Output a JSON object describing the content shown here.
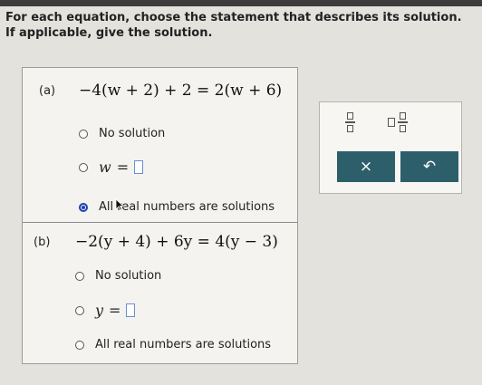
{
  "instructions": {
    "line1": "For each equation, choose the statement that describes its solution.",
    "line2": "If applicable, give the solution."
  },
  "parts": [
    {
      "label": "(a)",
      "equation": "−4(w + 2) + 2 = 2(w + 6)",
      "variable": "w",
      "options": {
        "no_solution": "No solution",
        "variable_eq": "=",
        "all_real": "All real numbers are solutions"
      },
      "selected": "all_real"
    },
    {
      "label": "(b)",
      "equation": "−2(y + 4) + 6y = 4(y − 3)",
      "variable": "y",
      "options": {
        "no_solution": "No solution",
        "variable_eq": "=",
        "all_real": "All real numbers are solutions"
      },
      "selected": null
    }
  ],
  "tools": {
    "fraction_icon": "fraction-icon",
    "mixed_number_icon": "mixed-number-icon",
    "clear_label": "×",
    "undo_label": "↶"
  },
  "colors": {
    "selected_radio": "#1a3fb0",
    "action_button": "#2d5f6b",
    "answer_box_border": "#6a8fd0"
  }
}
